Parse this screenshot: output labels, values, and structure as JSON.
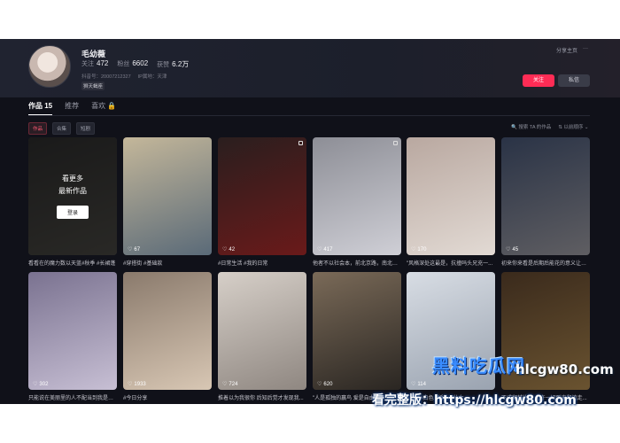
{
  "profile": {
    "name": "毛幼薇",
    "stats": [
      {
        "label": "关注",
        "value": "472"
      },
      {
        "label": "粉丝",
        "value": "6602"
      },
      {
        "label": "获赞",
        "value": "6.2万"
      }
    ],
    "meta": [
      "抖音号：20007212327",
      "IP属地：天津"
    ],
    "chip": "狮天蝎座",
    "share": "分享主页",
    "more": "···",
    "follow_label": "关注",
    "message_label": "私信"
  },
  "tabs": [
    {
      "label": "作品 15"
    },
    {
      "label": "推荐"
    },
    {
      "label": "喜欢 🔒"
    }
  ],
  "filters": [
    {
      "label": "作品"
    },
    {
      "label": "合集"
    },
    {
      "label": "短剧"
    }
  ],
  "search": {
    "label": "🔍 搜索 TA 的作品",
    "sort": "⇅ 以前顺序 ⌄"
  },
  "lock_overlay": {
    "line1": "看更多",
    "line2": "最新作品",
    "login": "登录"
  },
  "videos": [
    {
      "likes": "",
      "caption": "看看在的魔力数以天蓝#秋季 #长裙蓬",
      "colors": [
        "#3a3a3a",
        "#5c5a54"
      ]
    },
    {
      "likes": "67",
      "caption": "#穿搭街 #基础款",
      "colors": [
        "#c4b79a",
        "#5a6a78"
      ]
    },
    {
      "likes": "42",
      "caption": "#日常生活 #我的日常",
      "colors": [
        "#2a1e1e",
        "#6a1a1a"
      ]
    },
    {
      "likes": "417",
      "caption": "他者不以社会本，前北京路，南北京...",
      "colors": [
        "#8d8e96",
        "#cfcfd6"
      ]
    },
    {
      "likes": "170",
      "caption": "\"风格深处这最是，抗撞吗头兄充一...",
      "colors": [
        "#b9a8a0",
        "#e2dad4"
      ]
    },
    {
      "likes": "45",
      "caption": "初来你来看是后期后能花的意义让什么...",
      "colors": [
        "#2a3346",
        "#5f5e62"
      ]
    },
    {
      "likes": "302",
      "caption": "只能说在美丽里的人不配当到我是一...",
      "colors": [
        "#7a7290",
        "#c7bfd4"
      ]
    },
    {
      "likes": "1933",
      "caption": "#今日分享",
      "colors": [
        "#8a7a6c",
        "#d8c7b4"
      ]
    },
    {
      "likes": "724",
      "caption": "推着以为我很你 后知后觉才发现我...",
      "colors": [
        "#d6cfc8",
        "#8f8781"
      ]
    },
    {
      "likes": "620",
      "caption": "\"人是孤独的赢鸟 爱是自由的豆\"...",
      "colors": [
        "#7a6a58",
        "#2a2622"
      ]
    },
    {
      "likes": "114",
      "caption": "#穿搭#白色 #婚礼 #仙女",
      "colors": [
        "#d8dde4",
        "#9aa3b0"
      ]
    },
    {
      "likes": "",
      "caption": "不成翻越片子 允许一切到来和流走...",
      "colors": [
        "#3a2a1c",
        "#6a5330"
      ]
    }
  ],
  "watermark": {
    "brand": "黑料吃瓜网",
    "url": ".com",
    "url_host": "hlcgw80",
    "full_text": "看完整版：https://hlcgw80.com"
  }
}
